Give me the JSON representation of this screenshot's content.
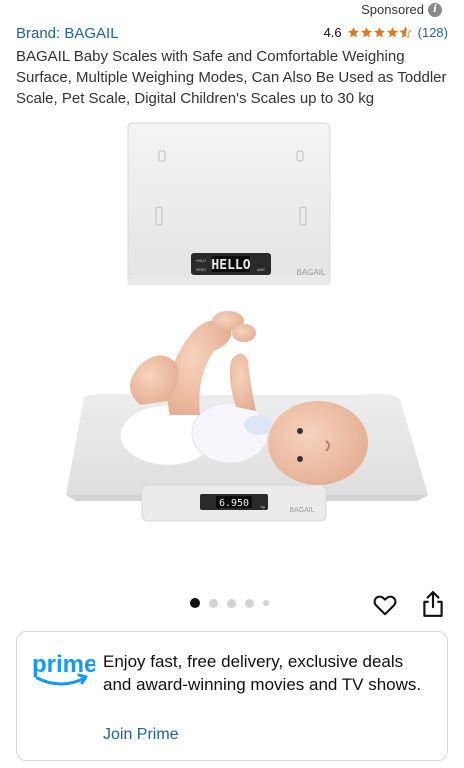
{
  "header": {
    "sponsored_label": "Sponsored",
    "info_icon": "info-icon"
  },
  "product": {
    "brand": "Brand: BAGAIL",
    "rating_value": "4.6",
    "rating_stars": 4.6,
    "rating_count": "(128)",
    "title": "BAGAIL Baby Scales with Safe and Comfortable Weighing Surface, Multiple Weighing Modes, Can Also Be Used as Toddler Scale, Pet Scale, Digital Children's Scales up to 30 kg"
  },
  "image": {
    "scale_display_top": "HELLO",
    "scale_display_bottom": "6.950",
    "brand_mark": "BAGAIL",
    "hold_label": "HOLD",
    "zero_label": "ZERO",
    "unit_label": "UNIT",
    "weight_unit": "kg"
  },
  "carousel": {
    "total_dots": 5,
    "active_index": 0
  },
  "actions": {
    "heart_icon": "heart-icon",
    "share_icon": "share-icon"
  },
  "prime": {
    "logo_text": "prime",
    "message": "Enjoy fast, free delivery, exclusive deals and award-winning movies and TV shows.",
    "cta": "Join Prime"
  },
  "colors": {
    "link": "#2162a1",
    "star": "#de7921",
    "prime_blue": "#1399ff"
  }
}
